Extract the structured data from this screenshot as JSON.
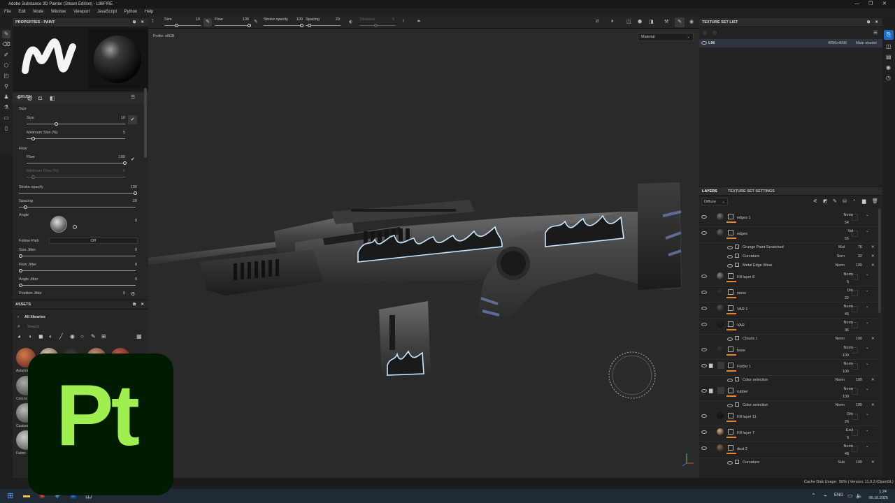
{
  "app": {
    "title": "Adobe Substance 3D Painter (Steam Edition) - L96FIRE",
    "window_controls": [
      "—",
      "❐",
      "✕"
    ]
  },
  "menu": [
    "File",
    "Edit",
    "Mode",
    "Window",
    "Viewport",
    "JavaScript",
    "Python",
    "Help"
  ],
  "toolbar": {
    "size_label": "Size",
    "size_value": "10",
    "flow_label": "Flow",
    "flow_value": "100",
    "stroke_label": "Stroke opacity",
    "stroke_value": "100",
    "spacing_label": "Spacing",
    "spacing_value": "20",
    "distance_label": "Distance",
    "distance_value": "5"
  },
  "properties": {
    "title": "PROPERTIES - PAINT",
    "brush_heading": "BRUSH",
    "size_group": "Size",
    "size_label": "Size",
    "size_value": "10",
    "minsize_label": "Minimum Size (%)",
    "minsize_value": "5",
    "flow_group": "Flow",
    "flow_label": "Flow",
    "flow_value": "100",
    "minflow_label": "Minimum Flow (%)",
    "minflow_value": "5",
    "stroke_label": "Stroke opacity",
    "stroke_value": "100",
    "spacing_label": "Spacing",
    "spacing_value": "20",
    "angle_label": "Angle",
    "angle_value": "0",
    "followpath_label": "Follow Path",
    "followpath_value": "Off",
    "sizejitter_label": "Size Jitter",
    "sizejitter_value": "0",
    "flowjitter_label": "Flow Jitter",
    "flowjitter_value": "0",
    "anglejitter_label": "Angle Jitter",
    "anglejitter_value": "0",
    "posjitter_label": "Position Jitter",
    "posjitter_value": "0"
  },
  "assets": {
    "title": "ASSETS",
    "library": "All libraries",
    "search_placeholder": "Search",
    "items": [
      "Autumn",
      "Concre",
      "Custom",
      "Fabric"
    ]
  },
  "viewport": {
    "profile": "Profile: sRGB",
    "material_mode": "Material"
  },
  "texture_set_list": {
    "title": "TEXTURE SET LIST",
    "row_name": "L96",
    "row_res": "4096x4096",
    "row_shader": "Main shader"
  },
  "layers_panel": {
    "tab_layers": "LAYERS",
    "tab_tss": "TEXTURE SET SETTINGS",
    "channel": "Diffuse",
    "rows": [
      {
        "name": "edges 1",
        "blend": "Norm",
        "opacity": "54",
        "indent": 0,
        "thumb": "#777"
      },
      {
        "name": "edges",
        "blend": "Val",
        "opacity": "55",
        "indent": 0,
        "thumb": "#666"
      },
      {
        "name": "Grunge Paint Scratched",
        "blend": "Mul",
        "opacity": "76",
        "indent": 1,
        "sub": true
      },
      {
        "name": "Curvature",
        "blend": "Scrn",
        "opacity": "32",
        "indent": 1,
        "sub": true
      },
      {
        "name": "Metal Edge Wear",
        "blend": "Norm",
        "opacity": "100",
        "indent": 1,
        "sub": true
      },
      {
        "name": "Fill layer 8",
        "blend": "Norm",
        "opacity": "5",
        "indent": 0,
        "thumb": "#888"
      },
      {
        "name": "noise",
        "blend": "Drk",
        "opacity": "22",
        "indent": 0,
        "thumb": "#333"
      },
      {
        "name": "VAR 1",
        "blend": "Norm",
        "opacity": "46",
        "indent": 0,
        "thumb": "#555"
      },
      {
        "name": "VAR",
        "blend": "Norm",
        "opacity": "36",
        "indent": 0,
        "thumb": "#222"
      },
      {
        "name": "Clouds 1",
        "blend": "Norm",
        "opacity": "100",
        "indent": 1,
        "sub": true
      },
      {
        "name": "base",
        "blend": "Norm",
        "opacity": "100",
        "indent": 0,
        "thumb": "#3a3a3a"
      },
      {
        "name": "Folder 1",
        "blend": "Norm",
        "opacity": "100",
        "indent": 0,
        "folder": true
      },
      {
        "name": "Color selection",
        "blend": "Norm",
        "opacity": "100",
        "indent": 1,
        "sub": true
      },
      {
        "name": "rubber",
        "blend": "Norm",
        "opacity": "100",
        "indent": 0,
        "folder": true
      },
      {
        "name": "Color selection",
        "blend": "Norm",
        "opacity": "100",
        "indent": 1,
        "sub": true
      },
      {
        "name": "Fill layer 11",
        "blend": "Drk",
        "opacity": "26",
        "indent": 0,
        "thumb": "#1a1a1a"
      },
      {
        "name": "Fill layer 7",
        "blend": "Excl",
        "opacity": "5",
        "indent": 0,
        "thumb": "#d8b080"
      },
      {
        "name": "dust 2",
        "blend": "Norm",
        "opacity": "48",
        "indent": 0,
        "thumb": "#8a6a50"
      },
      {
        "name": "Curvature",
        "blend": "Sub",
        "opacity": "100",
        "indent": 1,
        "sub": true
      }
    ]
  },
  "status": {
    "cache": "Cache Disk Usage:",
    "cache_value": "56% | Version: 11.0.3 (OpenGL)"
  },
  "taskbar": {
    "lang": "ENG",
    "time": "1:24",
    "date": "06.10.2025"
  },
  "logo_text": "Pt",
  "colors": {
    "accent": "#e8852a",
    "logo_bg": "#001c00",
    "logo_fg": "#9eef4f",
    "flame_outline": "#c8e8ff"
  }
}
